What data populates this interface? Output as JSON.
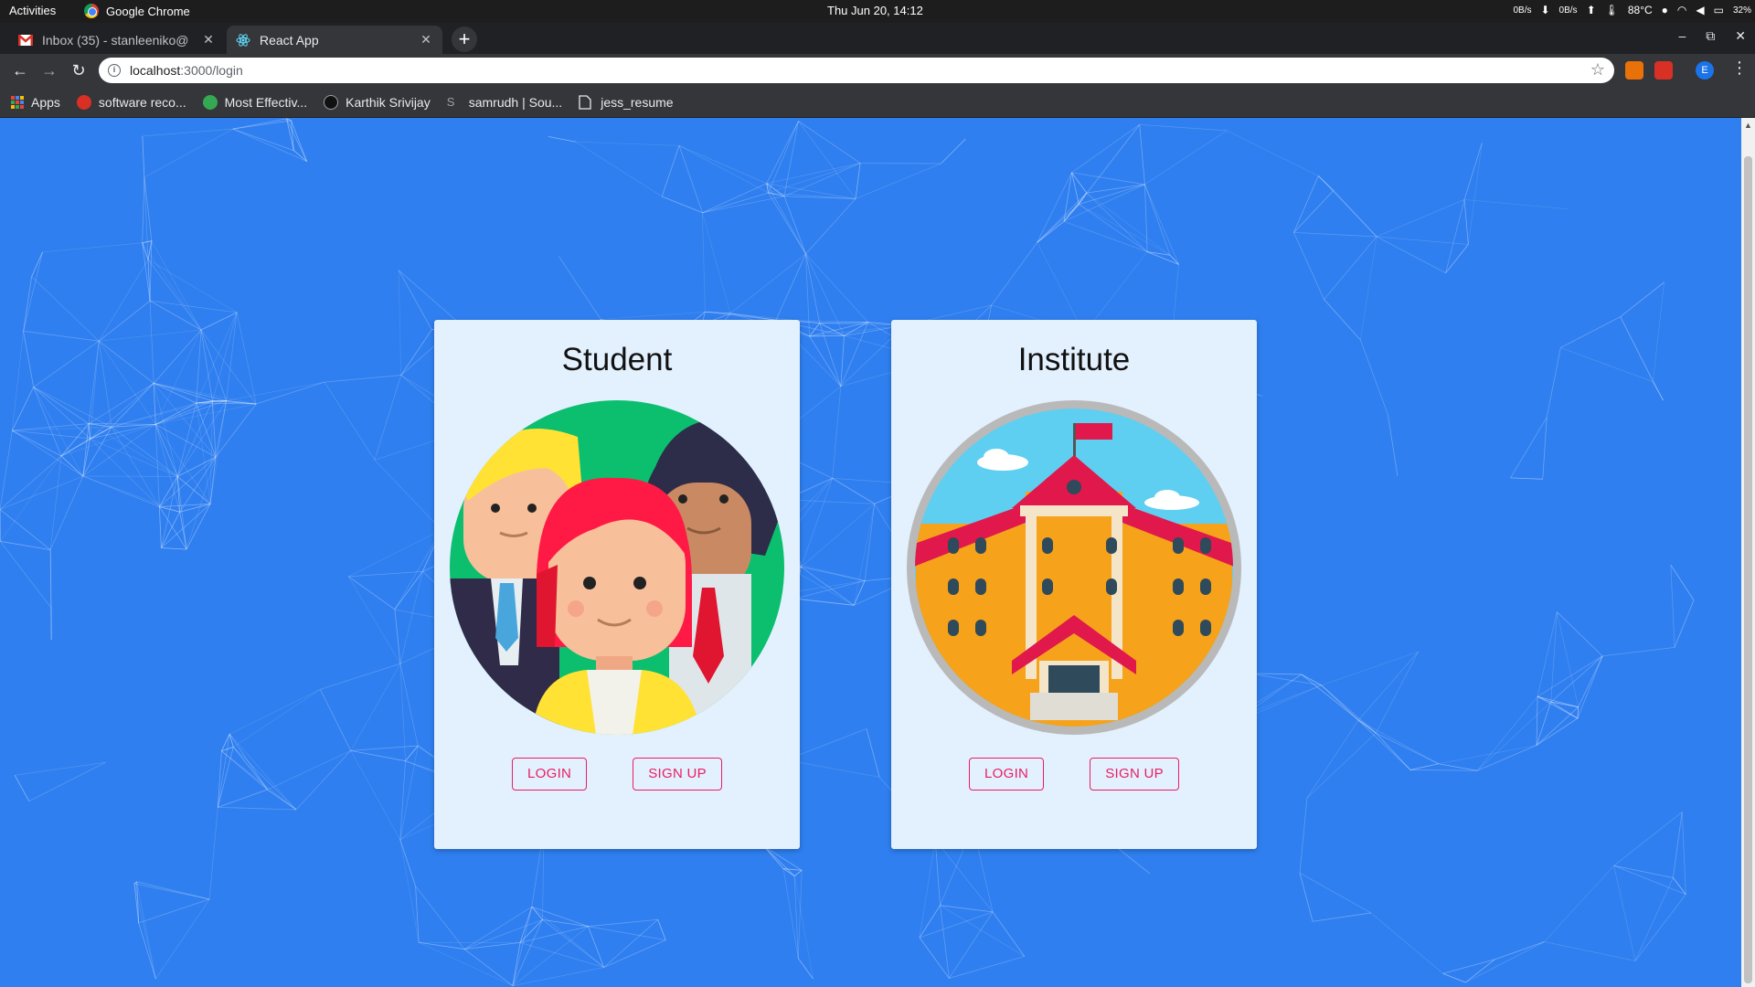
{
  "system_bar": {
    "activities": "Activities",
    "app_name": "Google Chrome",
    "clock": "Thu Jun 20, 14:12",
    "net_down": "0B/s",
    "net_up": "0B/s",
    "temperature": "88°C",
    "battery": "32%"
  },
  "tabs": [
    {
      "title": "Inbox (35) - stanleeniko@",
      "active": false,
      "icon": "gmail-icon"
    },
    {
      "title": "React App",
      "active": true,
      "icon": "react-icon"
    }
  ],
  "address_bar": {
    "host": "localhost",
    "path": ":3000/login"
  },
  "bookmarks": [
    {
      "label": "Apps",
      "icon": "apps-grid-icon"
    },
    {
      "label": "software reco...",
      "icon": "ask-icon"
    },
    {
      "label": "Most Effectiv...",
      "icon": "site-icon"
    },
    {
      "label": "Karthik Srivijay",
      "icon": "github-icon"
    },
    {
      "label": "samrudh | Sou...",
      "icon": "s-icon"
    },
    {
      "label": "jess_resume",
      "icon": "document-icon"
    }
  ],
  "page": {
    "background_color": "#2f7ff0",
    "cards": [
      {
        "title": "Student",
        "login_label": "LOGIN",
        "signup_label": "SIGN UP",
        "image": "students-illustration"
      },
      {
        "title": "Institute",
        "login_label": "LOGIN",
        "signup_label": "SIGN UP",
        "image": "institute-building-illustration"
      }
    ],
    "accent_color": "#e91e63"
  }
}
